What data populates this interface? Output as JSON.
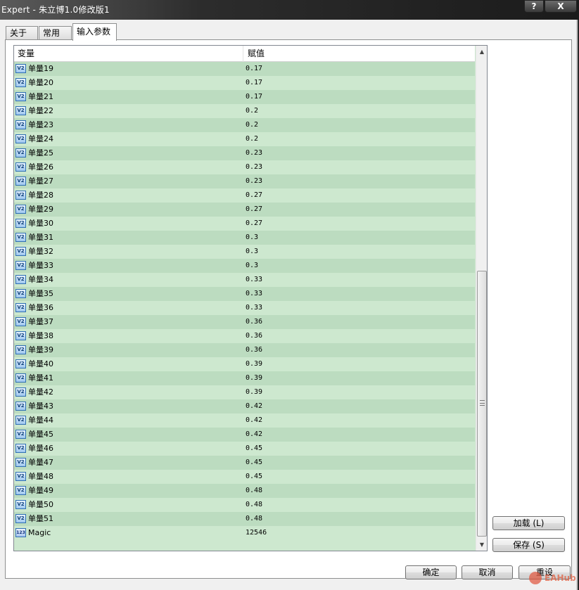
{
  "window": {
    "title": "Expert - 朱立博1.0修改版1",
    "help_label": "?",
    "close_label": "X"
  },
  "tabs": [
    {
      "label": "关于"
    },
    {
      "label": "常用"
    },
    {
      "label": "输入参数"
    }
  ],
  "table": {
    "columns": [
      "变量",
      "赋值"
    ],
    "rows": [
      {
        "name": "单量19",
        "value": "0.17",
        "icon": "variable-icon"
      },
      {
        "name": "单量20",
        "value": "0.17",
        "icon": "variable-icon"
      },
      {
        "name": "单量21",
        "value": "0.17",
        "icon": "variable-icon"
      },
      {
        "name": "单量22",
        "value": "0.2",
        "icon": "variable-icon"
      },
      {
        "name": "单量23",
        "value": "0.2",
        "icon": "variable-icon"
      },
      {
        "name": "单量24",
        "value": "0.2",
        "icon": "variable-icon"
      },
      {
        "name": "单量25",
        "value": "0.23",
        "icon": "variable-icon"
      },
      {
        "name": "单量26",
        "value": "0.23",
        "icon": "variable-icon"
      },
      {
        "name": "单量27",
        "value": "0.23",
        "icon": "variable-icon"
      },
      {
        "name": "单量28",
        "value": "0.27",
        "icon": "variable-icon"
      },
      {
        "name": "单量29",
        "value": "0.27",
        "icon": "variable-icon"
      },
      {
        "name": "单量30",
        "value": "0.27",
        "icon": "variable-icon"
      },
      {
        "name": "单量31",
        "value": "0.3",
        "icon": "variable-icon"
      },
      {
        "name": "单量32",
        "value": "0.3",
        "icon": "variable-icon"
      },
      {
        "name": "单量33",
        "value": "0.3",
        "icon": "variable-icon"
      },
      {
        "name": "单量34",
        "value": "0.33",
        "icon": "variable-icon"
      },
      {
        "name": "单量35",
        "value": "0.33",
        "icon": "variable-icon"
      },
      {
        "name": "单量36",
        "value": "0.33",
        "icon": "variable-icon"
      },
      {
        "name": "单量37",
        "value": "0.36",
        "icon": "variable-icon"
      },
      {
        "name": "单量38",
        "value": "0.36",
        "icon": "variable-icon"
      },
      {
        "name": "单量39",
        "value": "0.36",
        "icon": "variable-icon"
      },
      {
        "name": "单量40",
        "value": "0.39",
        "icon": "variable-icon"
      },
      {
        "name": "单量41",
        "value": "0.39",
        "icon": "variable-icon"
      },
      {
        "name": "单量42",
        "value": "0.39",
        "icon": "variable-icon"
      },
      {
        "name": "单量43",
        "value": "0.42",
        "icon": "variable-icon"
      },
      {
        "name": "单量44",
        "value": "0.42",
        "icon": "variable-icon"
      },
      {
        "name": "单量45",
        "value": "0.42",
        "icon": "variable-icon"
      },
      {
        "name": "单量46",
        "value": "0.45",
        "icon": "variable-icon"
      },
      {
        "name": "单量47",
        "value": "0.45",
        "icon": "variable-icon"
      },
      {
        "name": "单量48",
        "value": "0.45",
        "icon": "variable-icon"
      },
      {
        "name": "单量49",
        "value": "0.48",
        "icon": "variable-icon"
      },
      {
        "name": "单量50",
        "value": "0.48",
        "icon": "variable-icon"
      },
      {
        "name": "单量51",
        "value": "0.48",
        "icon": "variable-icon"
      },
      {
        "name": "Magic",
        "value": "12546",
        "icon": "integer-icon"
      }
    ]
  },
  "icons": {
    "variable_glyph": "V2",
    "integer_glyph": "123"
  },
  "buttons": {
    "load": "加载 (L)",
    "save": "保存 (S)",
    "ok": "确定",
    "cancel": "取消",
    "reset": "重设"
  },
  "watermark": {
    "text": "EAHub"
  }
}
